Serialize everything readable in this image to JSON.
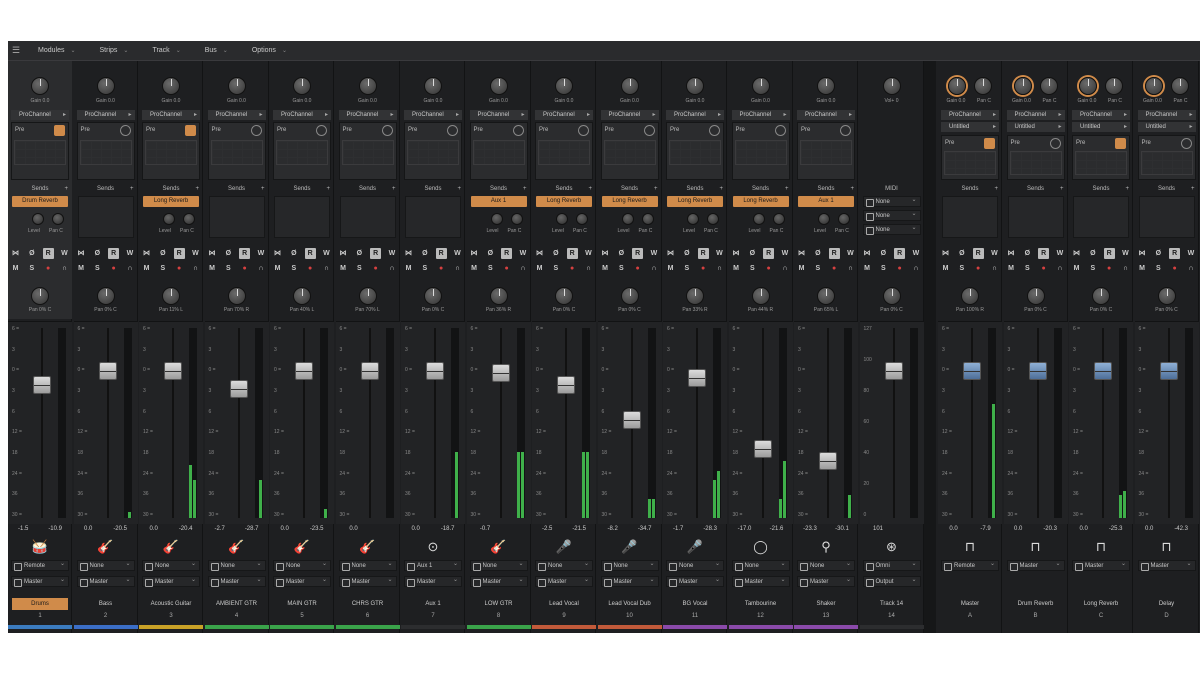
{
  "menubar": {
    "menus": [
      "Modules",
      "Strips",
      "Track",
      "Bus",
      "Options"
    ]
  },
  "strip_labels": {
    "gain_prefix": "Gain 0.0",
    "prochannel": "ProChannel",
    "pre": "Pre",
    "sends": "Sends",
    "midi_header": "MIDI",
    "vol_label": "Vol+ 0",
    "level": "Level",
    "pan_c": "Pan C"
  },
  "strips": [
    {
      "name": "Drums",
      "number": "1",
      "selected": true,
      "pan": "Pan 0% C",
      "send": "Drum Reverb",
      "peak_l": "-1.5",
      "peak_r": "-10.9",
      "input": "Remote",
      "output": "Master",
      "icon": "drums-icon",
      "color": "#3b7bbf",
      "fader": 0.72,
      "meter_l": 0.0,
      "meter_r": 0.0
    },
    {
      "name": "Bass",
      "number": "2",
      "pan": "Pan 0% C",
      "send": "",
      "peak_l": "0.0",
      "peak_r": "-20.5",
      "input": "None",
      "output": "Master",
      "icon": "bass-icon",
      "color": "#3b6ec7",
      "fader": 0.8,
      "meter_l": 0.0,
      "meter_r": 0.03
    },
    {
      "name": "Acoustic Guitar",
      "number": "3",
      "pan": "Pan 11% L",
      "send": "Long Reverb",
      "peak_l": "0.0",
      "peak_r": "-20.4",
      "input": "None",
      "output": "Master",
      "icon": "acoustic-guitar-icon",
      "color": "#c9a227",
      "fader": 0.8,
      "meter_l": 0.28,
      "meter_r": 0.2
    },
    {
      "name": "AMBIENT GTR",
      "number": "4",
      "pan": "Pan 70% R",
      "send": "",
      "peak_l": "-2.7",
      "peak_r": "-28.7",
      "input": "None",
      "output": "Master",
      "icon": "electric-guitar-icon",
      "color": "#3aa34a",
      "fader": 0.7,
      "meter_l": 0.0,
      "meter_r": 0.2
    },
    {
      "name": "MAIN GTR",
      "number": "5",
      "pan": "Pan 40% L",
      "send": "",
      "peak_l": "0.0",
      "peak_r": "-23.5",
      "input": "None",
      "output": "Master",
      "icon": "electric-guitar-icon",
      "color": "#3aa34a",
      "fader": 0.8,
      "meter_l": 0.0,
      "meter_r": 0.05
    },
    {
      "name": "CHRS GTR",
      "number": "6",
      "pan": "Pan 70% L",
      "send": "",
      "peak_l": "0.0",
      "peak_r": "",
      "input": "None",
      "output": "Master",
      "icon": "electric-guitar-icon",
      "color": "#3aa34a",
      "fader": 0.8,
      "meter_l": 0.0,
      "meter_r": 0.0
    },
    {
      "name": "Aux 1",
      "number": "7",
      "pan": "Pan 0% C",
      "send": "",
      "peak_l": "0.0",
      "peak_r": "-18.7",
      "input": "Aux 1",
      "output": "Master",
      "icon": "aux-input-icon",
      "color": "#2c2d2f",
      "fader": 0.8,
      "meter_l": 0.0,
      "meter_r": 0.35
    },
    {
      "name": "LOW GTR",
      "number": "8",
      "pan": "Pan 36% R",
      "send": "Aux 1",
      "peak_l": "-0.7",
      "peak_r": "",
      "input": "None",
      "output": "Master",
      "icon": "electric-guitar-icon",
      "color": "#3aa34a",
      "fader": 0.79,
      "meter_l": 0.35,
      "meter_r": 0.35
    },
    {
      "name": "Lead Vocal",
      "number": "9",
      "pan": "Pan 0% C",
      "send": "Long Reverb",
      "peak_l": "-2.5",
      "peak_r": "-21.5",
      "input": "None",
      "output": "Master",
      "icon": "microphone-icon",
      "color": "#c25a3a",
      "fader": 0.72,
      "meter_l": 0.35,
      "meter_r": 0.35
    },
    {
      "name": "Lead Vocal Dub",
      "number": "10",
      "pan": "Pan 0% C",
      "send": "Long Reverb",
      "peak_l": "-8.2",
      "peak_r": "-34.7",
      "input": "None",
      "output": "Master",
      "icon": "microphone-icon",
      "color": "#c25a3a",
      "fader": 0.52,
      "meter_l": 0.1,
      "meter_r": 0.1
    },
    {
      "name": "BG Vocal",
      "number": "11",
      "pan": "Pan 33% R",
      "send": "Long Reverb",
      "peak_l": "-1.7",
      "peak_r": "-28.3",
      "input": "None",
      "output": "Master",
      "icon": "microphone-icon",
      "color": "#8a4aaa",
      "fader": 0.76,
      "meter_l": 0.2,
      "meter_r": 0.25
    },
    {
      "name": "Tambourine",
      "number": "12",
      "pan": "Pan 44% R",
      "send": "Long Reverb",
      "peak_l": "-17.0",
      "peak_r": "-21.6",
      "input": "None",
      "output": "Master",
      "icon": "tambourine-icon",
      "color": "#8a4aaa",
      "fader": 0.35,
      "meter_l": 0.1,
      "meter_r": 0.3
    },
    {
      "name": "Shaker",
      "number": "13",
      "pan": "Pan 65% L",
      "send": "Aux 1",
      "peak_l": "-23.3",
      "peak_r": "-30.1",
      "input": "None",
      "output": "Master",
      "icon": "shaker-icon",
      "color": "#8a4aaa",
      "fader": 0.28,
      "meter_l": 0.0,
      "meter_r": 0.12
    },
    {
      "name": "Track 14",
      "number": "14",
      "midi": true,
      "pan": "Pan 0% C",
      "send": "",
      "peak_l": "101",
      "peak_r": "",
      "input": "Omni",
      "output": "Output",
      "icon": "midi-keyboard-icon",
      "color": "#2c2d2f",
      "fader": 0.8,
      "meter_l": 0.0,
      "meter_r": 0.0
    }
  ],
  "midi_rows": [
    {
      "ch": "C",
      "val": "None"
    },
    {
      "ch": "B",
      "val": "None"
    },
    {
      "ch": "P",
      "val": "None"
    }
  ],
  "buses": [
    {
      "name": "Master",
      "number": "A",
      "pan": "Pan 100% R",
      "peak_l": "0.0",
      "peak_r": "-7.9",
      "output": "Remote",
      "untitled": "Untitled",
      "fader": 0.8,
      "meter_l": 0.0,
      "meter_r": 0.6
    },
    {
      "name": "Drum Reverb",
      "number": "B",
      "pan": "Pan 0% C",
      "peak_l": "0.0",
      "peak_r": "-20.3",
      "output": "Master",
      "untitled": "Untitled",
      "fader": 0.8,
      "meter_l": 0.0,
      "meter_r": 0.0
    },
    {
      "name": "Long Reverb",
      "number": "C",
      "pan": "Pan 0% C",
      "peak_l": "0.0",
      "peak_r": "-25.3",
      "output": "Master",
      "untitled": "Untitled",
      "fader": 0.8,
      "meter_l": 0.12,
      "meter_r": 0.14
    },
    {
      "name": "Delay",
      "number": "D",
      "pan": "Pan 0% C",
      "peak_l": "0.0",
      "peak_r": "-42.3",
      "output": "Master",
      "untitled": "Untitled",
      "fader": 0.8,
      "meter_l": 0.0,
      "meter_r": 0.0
    }
  ],
  "bus_labels": {
    "gain": "Gain 0.0",
    "pan": "Pan C"
  },
  "scale_ticks": [
    "6 =",
    "3",
    "0 =",
    "3",
    "6",
    "12 =",
    "18",
    "24 =",
    "36",
    "30 ="
  ],
  "midi_scale_ticks": [
    "127",
    "100",
    "80",
    "60",
    "40",
    "20",
    "0"
  ]
}
